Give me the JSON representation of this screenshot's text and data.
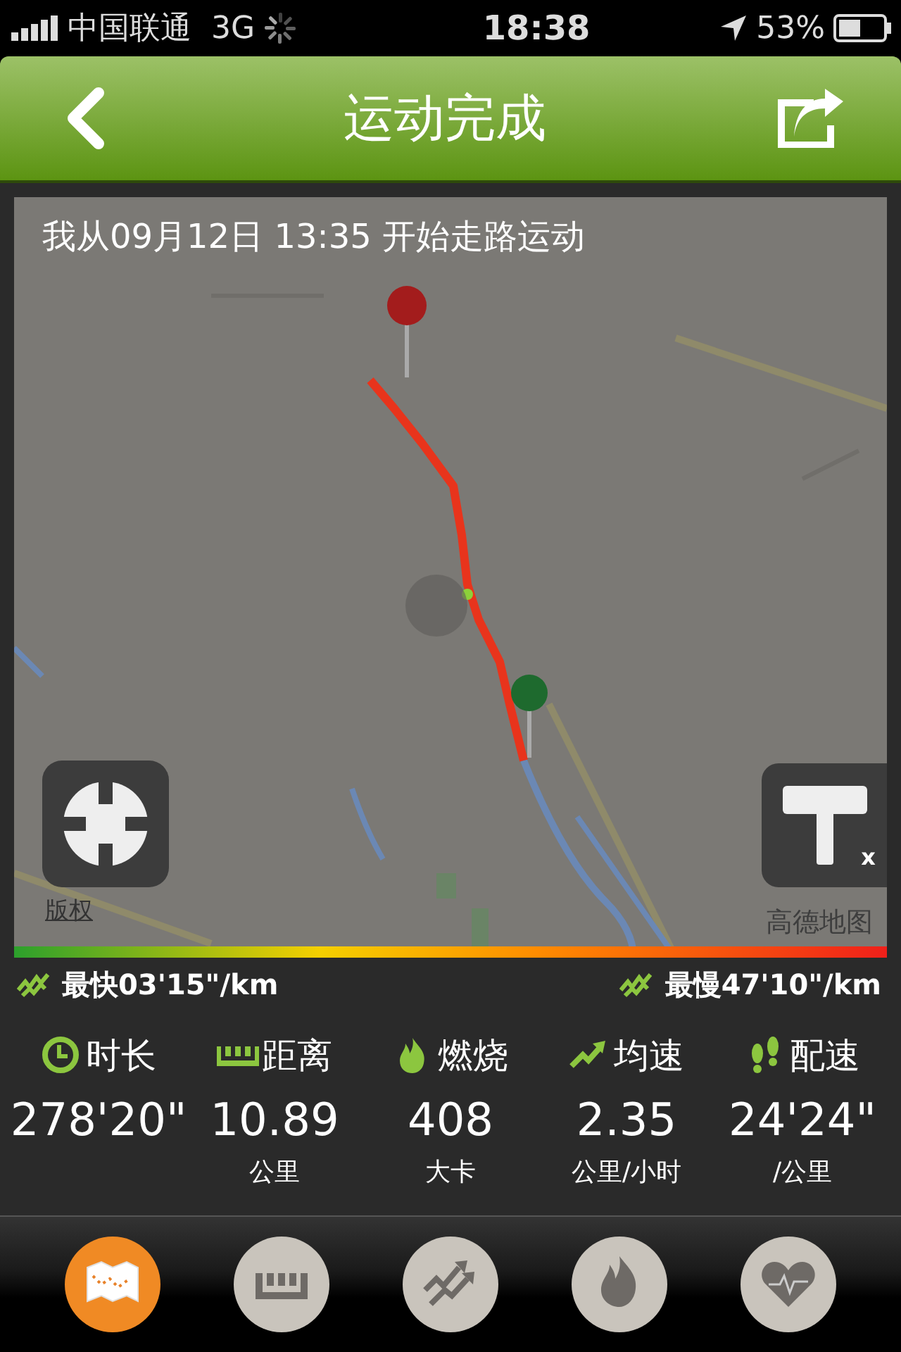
{
  "status_bar": {
    "carrier": "中国联通",
    "network": "3G",
    "time": "18:38",
    "battery": "53%"
  },
  "nav": {
    "title": "运动完成"
  },
  "map": {
    "caption": "我从09月12日 13:35 开始走路运动",
    "copyright": "版权",
    "provider": "高德地图",
    "close_mark": "x"
  },
  "pace": {
    "fastest": "最快03'15\"/km",
    "slowest": "最慢47'10\"/km"
  },
  "stats": [
    {
      "kind": "clock",
      "label": "时长",
      "value": "278'20\""
    },
    {
      "kind": "ruler",
      "label": "距离",
      "value": "10.89",
      "unit": "公里"
    },
    {
      "kind": "flame",
      "label": "燃烧",
      "value": "408",
      "unit": "大卡"
    },
    {
      "kind": "trend",
      "label": "均速",
      "value": "2.35",
      "unit": "公里/小时"
    },
    {
      "kind": "steps",
      "label": "配速",
      "value": "24'24\"",
      "unit": "/公里"
    }
  ],
  "tabs": [
    {
      "kind": "map",
      "selected": true
    },
    {
      "kind": "ruler",
      "selected": false
    },
    {
      "kind": "trend",
      "selected": false
    },
    {
      "kind": "flame",
      "selected": false
    },
    {
      "kind": "heart",
      "selected": false
    }
  ]
}
